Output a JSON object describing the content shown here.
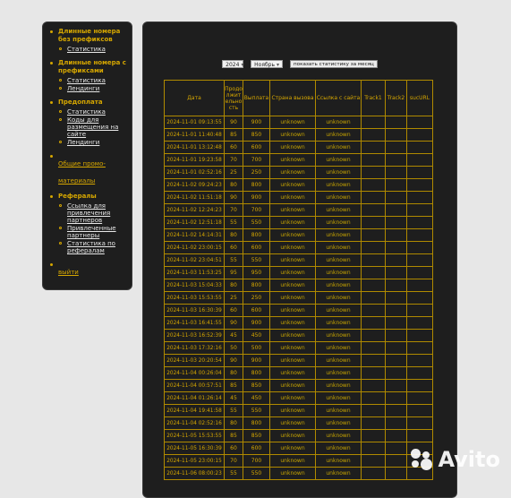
{
  "sidebar": {
    "sections": [
      {
        "title": "Длинные номера без префиксов",
        "items": [
          "Статистика"
        ]
      },
      {
        "title": "Длинные номера с префиксами",
        "items": [
          "Статистика",
          "Лендинги"
        ]
      },
      {
        "title": "Предоплата",
        "items": [
          "Статистика",
          "Коды для размещения на сайте",
          "Лендинги"
        ]
      },
      {
        "link": "Общие промо-материалы",
        "items": []
      },
      {
        "title": "Рефералы",
        "items": [
          "Ссылка для привлечения партнеров",
          "Привлеченные партнеры",
          "Статистика по рефералам"
        ]
      },
      {
        "link": "выйти",
        "items": []
      }
    ]
  },
  "filters": {
    "year": "2024",
    "month": "Ноябрь",
    "button_label": "показать статистику за месяц"
  },
  "table": {
    "headers": [
      "Дата",
      "Продолжительность",
      "Выплата",
      "Страна вызова",
      "Ссылка с сайта",
      "Track1",
      "Track2",
      "sucURL"
    ],
    "rows": [
      [
        "2024-11-01 09:13:55",
        "90",
        "900",
        "unknown",
        "unknown",
        "",
        "",
        ""
      ],
      [
        "2024-11-01 11:40:48",
        "85",
        "850",
        "unknown",
        "unknown",
        "",
        "",
        ""
      ],
      [
        "2024-11-01 13:12:48",
        "60",
        "600",
        "unknown",
        "unknown",
        "",
        "",
        ""
      ],
      [
        "2024-11-01 19:23:58",
        "70",
        "700",
        "unknown",
        "unknown",
        "",
        "",
        ""
      ],
      [
        "2024-11-01 02:52:16",
        "25",
        "250",
        "unknown",
        "unknown",
        "",
        "",
        ""
      ],
      [
        "2024-11-02 09:24:23",
        "80",
        "800",
        "unknown",
        "unknown",
        "",
        "",
        ""
      ],
      [
        "2024-11-02 11:51:18",
        "90",
        "900",
        "unknown",
        "unknown",
        "",
        "",
        ""
      ],
      [
        "2024-11-02 12:24:23",
        "70",
        "700",
        "unknown",
        "unknown",
        "",
        "",
        ""
      ],
      [
        "2024-11-02 12:51:18",
        "55",
        "550",
        "unknown",
        "unknown",
        "",
        "",
        ""
      ],
      [
        "2024-11-02 14:14:31",
        "80",
        "800",
        "unknown",
        "unknown",
        "",
        "",
        ""
      ],
      [
        "2024-11-02 23:00:15",
        "60",
        "600",
        "unknown",
        "unknown",
        "",
        "",
        ""
      ],
      [
        "2024-11-02 23:04:51",
        "55",
        "550",
        "unknown",
        "unknown",
        "",
        "",
        ""
      ],
      [
        "2024-11-03 11:53:25",
        "95",
        "950",
        "unknown",
        "unknown",
        "",
        "",
        ""
      ],
      [
        "2024-11-03 15:04:33",
        "80",
        "800",
        "unknown",
        "unknown",
        "",
        "",
        ""
      ],
      [
        "2024-11-03 15:53:55",
        "25",
        "250",
        "unknown",
        "unknown",
        "",
        "",
        ""
      ],
      [
        "2024-11-03 16:30:39",
        "60",
        "600",
        "unknown",
        "unknown",
        "",
        "",
        ""
      ],
      [
        "2024-11-03 16:41:55",
        "90",
        "900",
        "unknown",
        "unknown",
        "",
        "",
        ""
      ],
      [
        "2024-11-03 16:52:39",
        "45",
        "450",
        "unknown",
        "unknown",
        "",
        "",
        ""
      ],
      [
        "2024-11-03 17:32:16",
        "50",
        "500",
        "unknown",
        "unknown",
        "",
        "",
        ""
      ],
      [
        "2024-11-03 20:20:54",
        "90",
        "900",
        "unknown",
        "unknown",
        "",
        "",
        ""
      ],
      [
        "2024-11-04 00:26:04",
        "80",
        "800",
        "unknown",
        "unknown",
        "",
        "",
        ""
      ],
      [
        "2024-11-04 00:57:51",
        "85",
        "850",
        "unknown",
        "unknown",
        "",
        "",
        ""
      ],
      [
        "2024-11-04 01:26:14",
        "45",
        "450",
        "unknown",
        "unknown",
        "",
        "",
        ""
      ],
      [
        "2024-11-04 19:41:58",
        "55",
        "550",
        "unknown",
        "unknown",
        "",
        "",
        ""
      ],
      [
        "2024-11-04 02:52:16",
        "80",
        "800",
        "unknown",
        "unknown",
        "",
        "",
        ""
      ],
      [
        "2024-11-05 15:53:55",
        "85",
        "850",
        "unknown",
        "unknown",
        "",
        "",
        ""
      ],
      [
        "2024-11-05 16:30:39",
        "60",
        "600",
        "unknown",
        "unknown",
        "",
        "",
        ""
      ],
      [
        "2024-11-05 23:00:15",
        "70",
        "700",
        "unknown",
        "unknown",
        "",
        "",
        ""
      ],
      [
        "2024-11-06 08:00:23",
        "55",
        "550",
        "unknown",
        "unknown",
        "",
        "",
        ""
      ]
    ]
  },
  "watermark": "Avito"
}
